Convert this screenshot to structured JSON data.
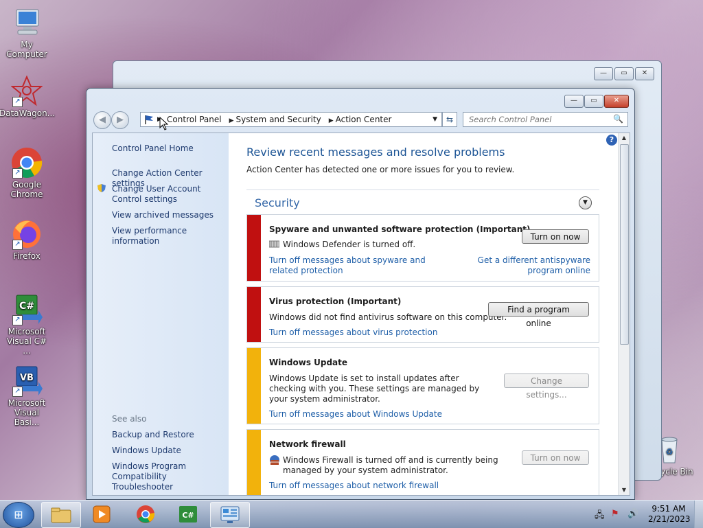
{
  "desktop": {
    "icons": [
      {
        "label": "My Computer"
      },
      {
        "label": "DataWagon..."
      },
      {
        "label": "Google Chrome"
      },
      {
        "label": "Firefox"
      },
      {
        "label": "Microsoft Visual C# ..."
      },
      {
        "label": "Microsoft Visual Basi..."
      },
      {
        "label": "Recycle Bin"
      }
    ]
  },
  "window": {
    "minimize": "—",
    "maximize": "▭",
    "close": "✕",
    "breadcrumb": [
      "Control Panel",
      "System and Security",
      "Action Center"
    ],
    "search_placeholder": "Search Control Panel"
  },
  "sidebar": {
    "home": "Control Panel Home",
    "links": [
      "Change Action Center settings",
      "Change User Account Control settings",
      "View archived messages",
      "View performance information"
    ],
    "see_also_title": "See also",
    "see_also": [
      "Backup and Restore",
      "Windows Update",
      "Windows Program Compatibility Troubleshooter"
    ]
  },
  "main": {
    "title": "Review recent messages and resolve problems",
    "subtitle": "Action Center has detected one or more issues for you to review.",
    "section": "Security",
    "cards": [
      {
        "title": "Spyware and unwanted software protection  (Important)",
        "desc": "Windows Defender is turned off.",
        "button": "Turn on now",
        "link_left": "Turn off messages about spyware and related protection",
        "link_right": "Get a different antispyware program online",
        "color": "#c01010"
      },
      {
        "title": "Virus protection  (Important)",
        "desc": "Windows did not find antivirus software on this computer.",
        "button": "Find a program online",
        "link_left": "Turn off messages about virus protection",
        "color": "#c01010"
      },
      {
        "title": "Windows Update",
        "desc": "Windows Update is set to install updates after checking with you.  These settings are managed by your system administrator.",
        "button": "Change settings...",
        "link_left": "Turn off messages about Windows Update",
        "color": "#f2b20c"
      },
      {
        "title": "Network firewall",
        "desc": "Windows Firewall is turned off and is currently being managed by your system administrator.",
        "button": "Turn on now",
        "link_left": "Turn off messages about network firewall",
        "color": "#f2b20c"
      }
    ]
  },
  "taskbar": {
    "time": "9:51 AM",
    "date": "2/21/2023"
  }
}
